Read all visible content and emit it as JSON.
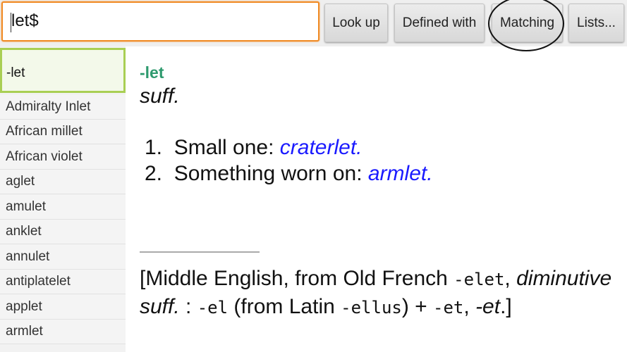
{
  "search": {
    "value": "let$"
  },
  "toolbar": {
    "lookup": "Look up",
    "defined_with": "Defined with",
    "matching": "Matching",
    "lists": "Lists..."
  },
  "sidebar": {
    "selected": "-let",
    "items": [
      "Admiralty Inlet",
      "African millet",
      "African violet",
      "aglet",
      "amulet",
      "anklet",
      "annulet",
      "antiplatelet",
      "applet",
      "armlet"
    ]
  },
  "entry": {
    "headword": "-let",
    "pos": "suff.",
    "definitions": [
      {
        "num": "1.",
        "text": "Small one: ",
        "example": "craterlet."
      },
      {
        "num": "2.",
        "text": "Something worn on: ",
        "example": "armlet."
      }
    ],
    "etymology": {
      "t1": "[Middle English, from Old French ",
      "m1": "-elet",
      "t2": ", ",
      "i1": "diminutive suff.",
      "t3": " : ",
      "m2": "-el",
      "t4": " (from Latin ",
      "m3": "-ellus",
      "t5": ") + ",
      "m4": "-et",
      "t6": ", ",
      "i2": "-et",
      "t7": ".]"
    }
  },
  "colors": {
    "accent_orange": "#f08a24",
    "headword_green": "#2e9a6e",
    "link_blue": "#1a1aff",
    "selected_border": "#a9cf54"
  }
}
